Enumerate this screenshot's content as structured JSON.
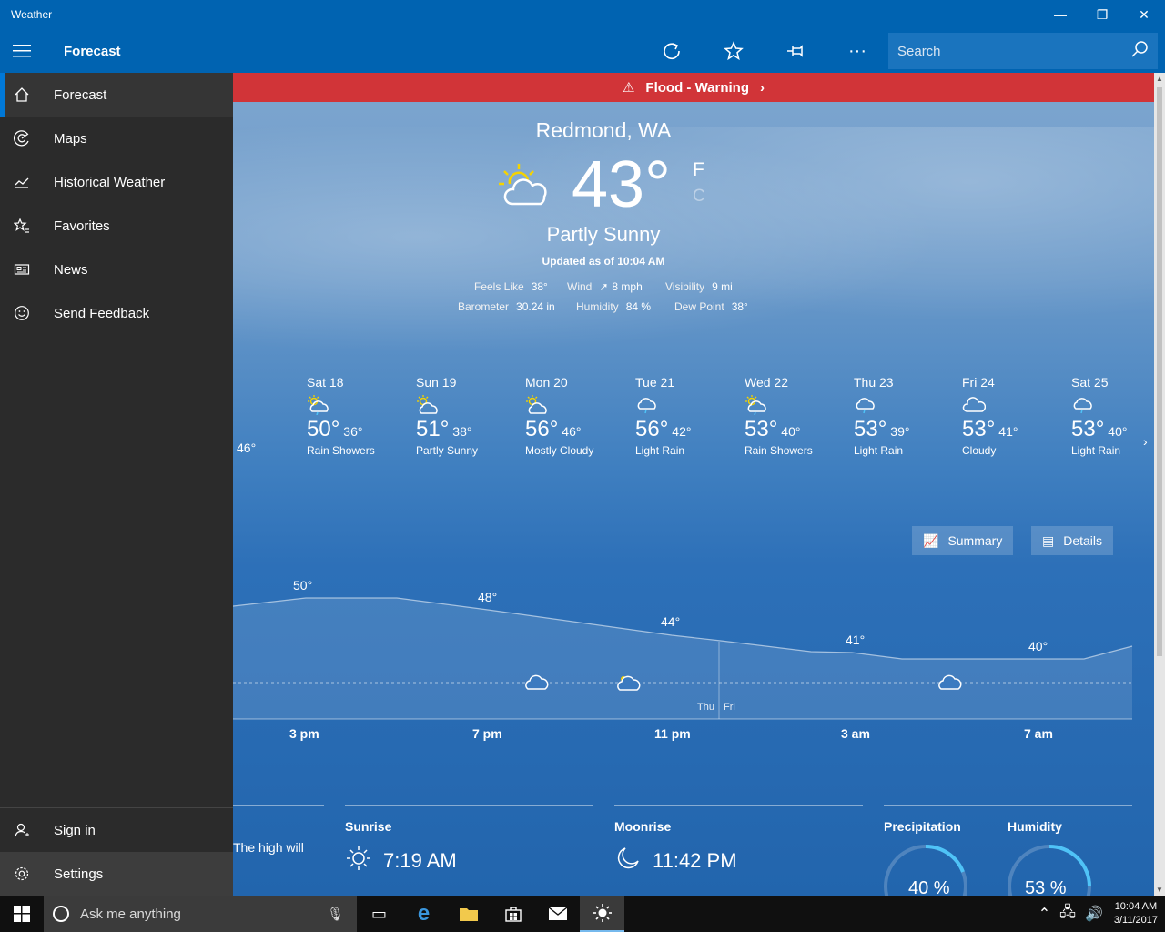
{
  "window": {
    "title": "Weather",
    "controls": {
      "minimize": "—",
      "restore": "❐",
      "close": "✕"
    }
  },
  "toolbar": {
    "title": "Forecast",
    "search_placeholder": "Search"
  },
  "sidebar": {
    "items": [
      {
        "label": "Forecast",
        "icon": "home-icon"
      },
      {
        "label": "Maps",
        "icon": "radar-icon"
      },
      {
        "label": "Historical Weather",
        "icon": "chart-icon"
      },
      {
        "label": "Favorites",
        "icon": "star-list-icon"
      },
      {
        "label": "News",
        "icon": "news-icon"
      },
      {
        "label": "Send Feedback",
        "icon": "smiley-icon"
      }
    ],
    "bottom": [
      {
        "label": "Sign in",
        "icon": "person-icon"
      },
      {
        "label": "Settings",
        "icon": "gear-icon"
      }
    ]
  },
  "alert": {
    "text": "Flood - Warning",
    "color": "#d13438"
  },
  "current": {
    "location": "Redmond, WA",
    "temp": "43°",
    "unit_f": "F",
    "unit_c": "C",
    "condition": "Partly Sunny",
    "updated": "Updated as of 10:04 AM",
    "feels_like_label": "Feels Like",
    "feels_like": "38°",
    "wind_label": "Wind",
    "wind": "8 mph",
    "visibility_label": "Visibility",
    "visibility": "9 mi",
    "barometer_label": "Barometer",
    "barometer": "30.24 in",
    "humidity_label": "Humidity",
    "humidity": "84 %",
    "dew_point_label": "Dew Point",
    "dew_point": "38°"
  },
  "daily_partial_lo": "46°",
  "daily": [
    {
      "day": "Sat 18",
      "hi": "50°",
      "lo": "36°",
      "cond": "Rain Showers",
      "icon": "sun-rain"
    },
    {
      "day": "Sun 19",
      "hi": "51°",
      "lo": "38°",
      "cond": "Partly Sunny",
      "icon": "sun-cloud"
    },
    {
      "day": "Mon 20",
      "hi": "56°",
      "lo": "46°",
      "cond": "Mostly Cloudy",
      "icon": "sun-cloud"
    },
    {
      "day": "Tue 21",
      "hi": "56°",
      "lo": "42°",
      "cond": "Light Rain",
      "icon": "rain"
    },
    {
      "day": "Wed 22",
      "hi": "53°",
      "lo": "40°",
      "cond": "Rain Showers",
      "icon": "sun-rain"
    },
    {
      "day": "Thu 23",
      "hi": "53°",
      "lo": "39°",
      "cond": "Light Rain",
      "icon": "rain"
    },
    {
      "day": "Fri 24",
      "hi": "53°",
      "lo": "41°",
      "cond": "Cloudy",
      "icon": "cloud"
    },
    {
      "day": "Sat 25",
      "hi": "53°",
      "lo": "40°",
      "cond": "Light Rain",
      "icon": "rain"
    }
  ],
  "view_buttons": {
    "summary": "Summary",
    "details": "Details"
  },
  "hourly": {
    "temp_labels": [
      "50°",
      "48°",
      "44°",
      "41°",
      "40°"
    ],
    "time_labels": [
      "3 pm",
      "7 pm",
      "11 pm",
      "3 am",
      "7 am"
    ],
    "day_divider": {
      "left": "Thu",
      "right": "Fri"
    }
  },
  "bottom": {
    "summary_fragment": "The high will",
    "sunrise_label": "Sunrise",
    "sunrise": "7:19 AM",
    "moonrise_label": "Moonrise",
    "moonrise": "11:42 PM",
    "precip_label": "Precipitation",
    "precip": "40 %",
    "humidity_label": "Humidity",
    "humidity": "53 %"
  },
  "taskbar": {
    "cortana_placeholder": "Ask me anything",
    "time": "10:04 AM",
    "date": "3/11/2017"
  }
}
